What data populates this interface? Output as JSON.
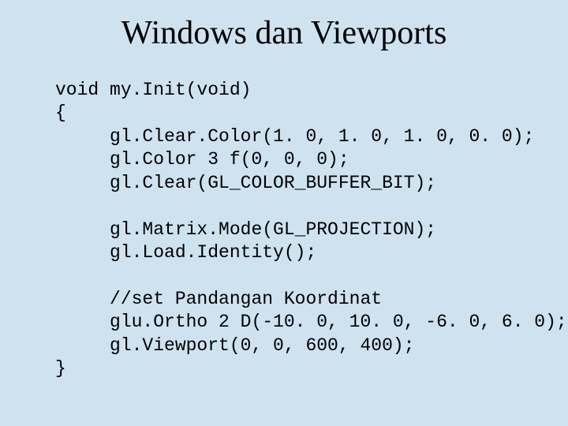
{
  "title": "Windows dan Viewports",
  "code": {
    "l1": "void my.Init(void)",
    "l2": "{",
    "l3": "     gl.Clear.Color(1. 0, 1. 0, 1. 0, 0. 0);",
    "l4": "     gl.Color 3 f(0, 0, 0);",
    "l5": "     gl.Clear(GL_COLOR_BUFFER_BIT);",
    "blank1": "",
    "l6": "     gl.Matrix.Mode(GL_PROJECTION);",
    "l7": "     gl.Load.Identity();",
    "blank2": "",
    "l8": "     //set Pandangan Koordinat",
    "l9": "     glu.Ortho 2 D(-10. 0, 10. 0, -6. 0, 6. 0);",
    "l10": "     gl.Viewport(0, 0, 600, 400);",
    "l11": "}"
  }
}
